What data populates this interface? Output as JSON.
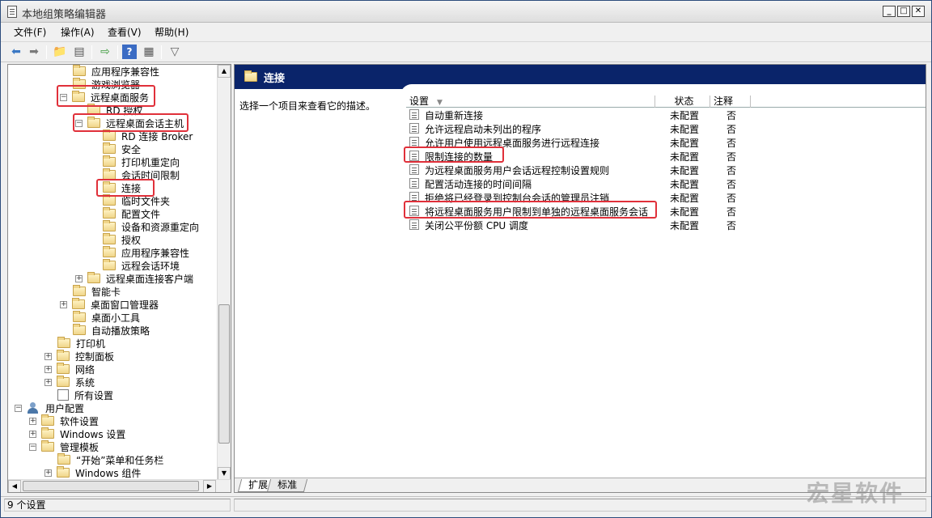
{
  "window": {
    "title": "本地组策略编辑器"
  },
  "menu": {
    "items": [
      "文件(F)",
      "操作(A)",
      "查看(V)",
      "帮助(H)"
    ]
  },
  "tree": {
    "items": [
      {
        "label": "应用程序兼容性"
      },
      {
        "label": "游戏浏览器"
      },
      {
        "label": "远程桌面服务",
        "expander": "−"
      },
      {
        "label": "RD 授权"
      },
      {
        "label": "远程桌面会话主机",
        "expander": "−"
      },
      {
        "label": "RD 连接 Broker"
      },
      {
        "label": "安全"
      },
      {
        "label": "打印机重定向"
      },
      {
        "label": "会话时间限制"
      },
      {
        "label": "连接"
      },
      {
        "label": "临时文件夹"
      },
      {
        "label": "配置文件"
      },
      {
        "label": "设备和资源重定向"
      },
      {
        "label": "授权"
      },
      {
        "label": "应用程序兼容性"
      },
      {
        "label": "远程会话环境"
      },
      {
        "label": "远程桌面连接客户端",
        "expander": "+"
      },
      {
        "label": "智能卡"
      },
      {
        "label": "桌面窗口管理器",
        "expander": "+"
      },
      {
        "label": "桌面小工具"
      },
      {
        "label": "自动播放策略"
      },
      {
        "label": "打印机"
      },
      {
        "label": "控制面板",
        "expander": "+"
      },
      {
        "label": "网络",
        "expander": "+"
      },
      {
        "label": "系统",
        "expander": "+"
      },
      {
        "label": "所有设置"
      },
      {
        "label": "用户配置",
        "expander": "−"
      },
      {
        "label": "软件设置",
        "expander": "+"
      },
      {
        "label": "Windows 设置",
        "expander": "+"
      },
      {
        "label": "管理模板",
        "expander": "−"
      },
      {
        "label": "“开始”菜单和任务栏"
      },
      {
        "label": "Windows 组件",
        "expander": "+"
      }
    ]
  },
  "right": {
    "header_title": "连接",
    "description": "选择一个项目来查看它的描述。",
    "columns": {
      "setting": "设置",
      "state": "状态",
      "comment": "注释"
    },
    "rows": [
      {
        "setting": "自动重新连接",
        "state": "未配置",
        "comment": "否"
      },
      {
        "setting": "允许远程启动未列出的程序",
        "state": "未配置",
        "comment": "否"
      },
      {
        "setting": "允许用户使用远程桌面服务进行远程连接",
        "state": "未配置",
        "comment": "否"
      },
      {
        "setting": "限制连接的数量",
        "state": "未配置",
        "comment": "否"
      },
      {
        "setting": "为远程桌面服务用户会话远程控制设置规则",
        "state": "未配置",
        "comment": "否"
      },
      {
        "setting": "配置活动连接的时间间隔",
        "state": "未配置",
        "comment": "否"
      },
      {
        "setting": "拒绝将已经登录到控制台会话的管理员注销",
        "state": "未配置",
        "comment": "否"
      },
      {
        "setting": "将远程桌面服务用户限制到单独的远程桌面服务会话",
        "state": "未配置",
        "comment": "否"
      },
      {
        "setting": "关闭公平份额 CPU 调度",
        "state": "未配置",
        "comment": "否"
      }
    ],
    "tabs": [
      "扩展",
      "标准"
    ]
  },
  "status": {
    "text": "9 个设置"
  },
  "watermark": "宏星软件"
}
